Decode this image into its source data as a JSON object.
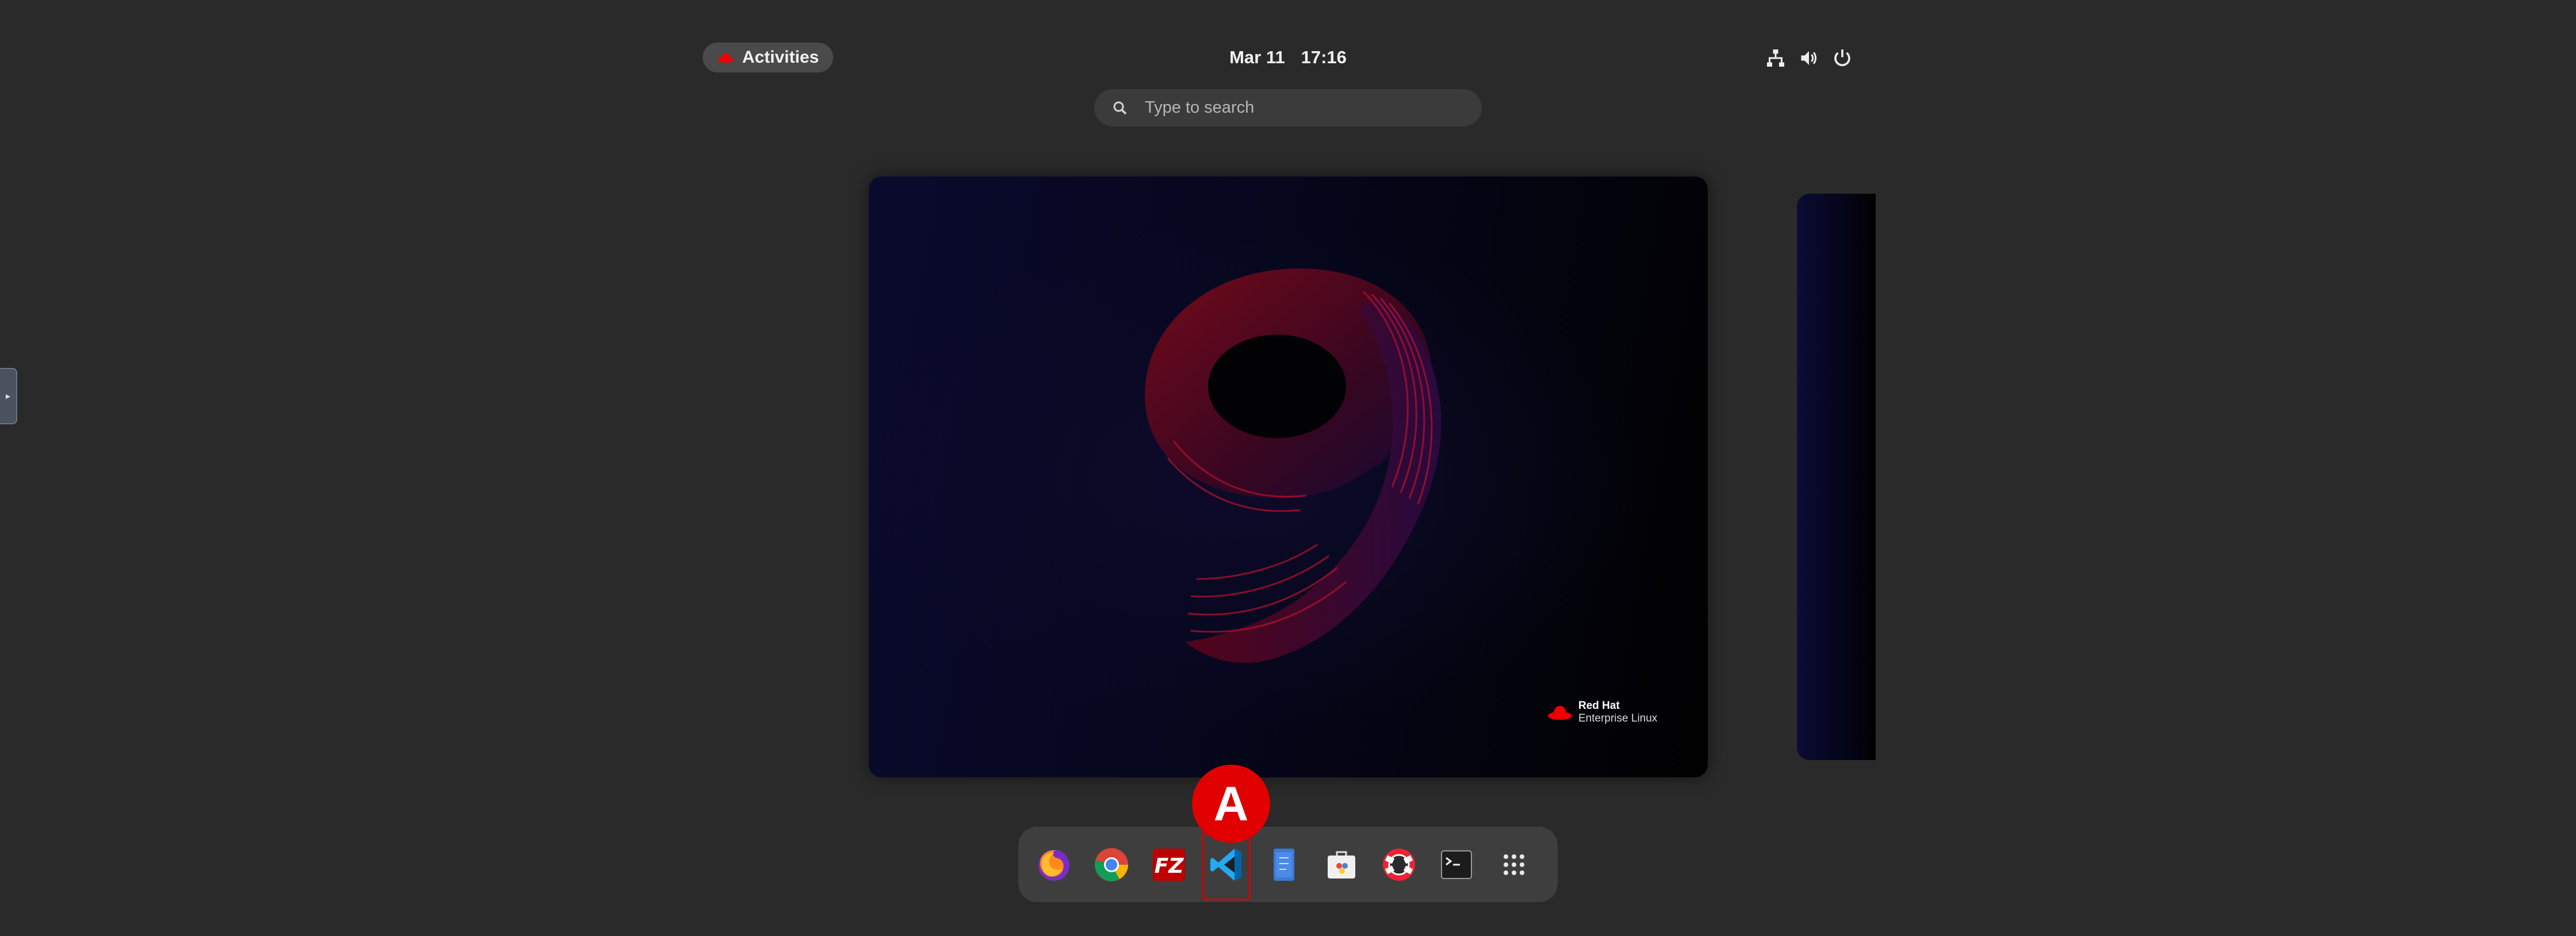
{
  "top_bar": {
    "activities_label": "Activities",
    "date": "Mar 11",
    "time": "17:16",
    "system_icons": [
      "network-icon",
      "volume-icon",
      "power-icon"
    ]
  },
  "search": {
    "placeholder": "Type to search"
  },
  "workspace": {
    "wallpaper_numeral": "9",
    "logo_line1": "Red Hat",
    "logo_line2": "Enterprise Linux"
  },
  "dash": {
    "apps": [
      {
        "name": "Firefox",
        "icon": "firefox-icon"
      },
      {
        "name": "Google Chrome",
        "icon": "chrome-icon"
      },
      {
        "name": "FileZilla",
        "icon": "filezilla-icon"
      },
      {
        "name": "Visual Studio Code",
        "icon": "vscode-icon",
        "selected": true
      },
      {
        "name": "Text Editor",
        "icon": "text-editor-icon"
      },
      {
        "name": "Software",
        "icon": "software-icon"
      },
      {
        "name": "Help",
        "icon": "help-icon"
      },
      {
        "name": "Terminal",
        "icon": "terminal-icon"
      },
      {
        "name": "Show Applications",
        "icon": "app-grid-icon"
      }
    ]
  },
  "annotation": {
    "marker_label": "A"
  },
  "colors": {
    "background": "#2a2a2a",
    "marker": "#e00000",
    "accent_red": "#ee0000"
  }
}
